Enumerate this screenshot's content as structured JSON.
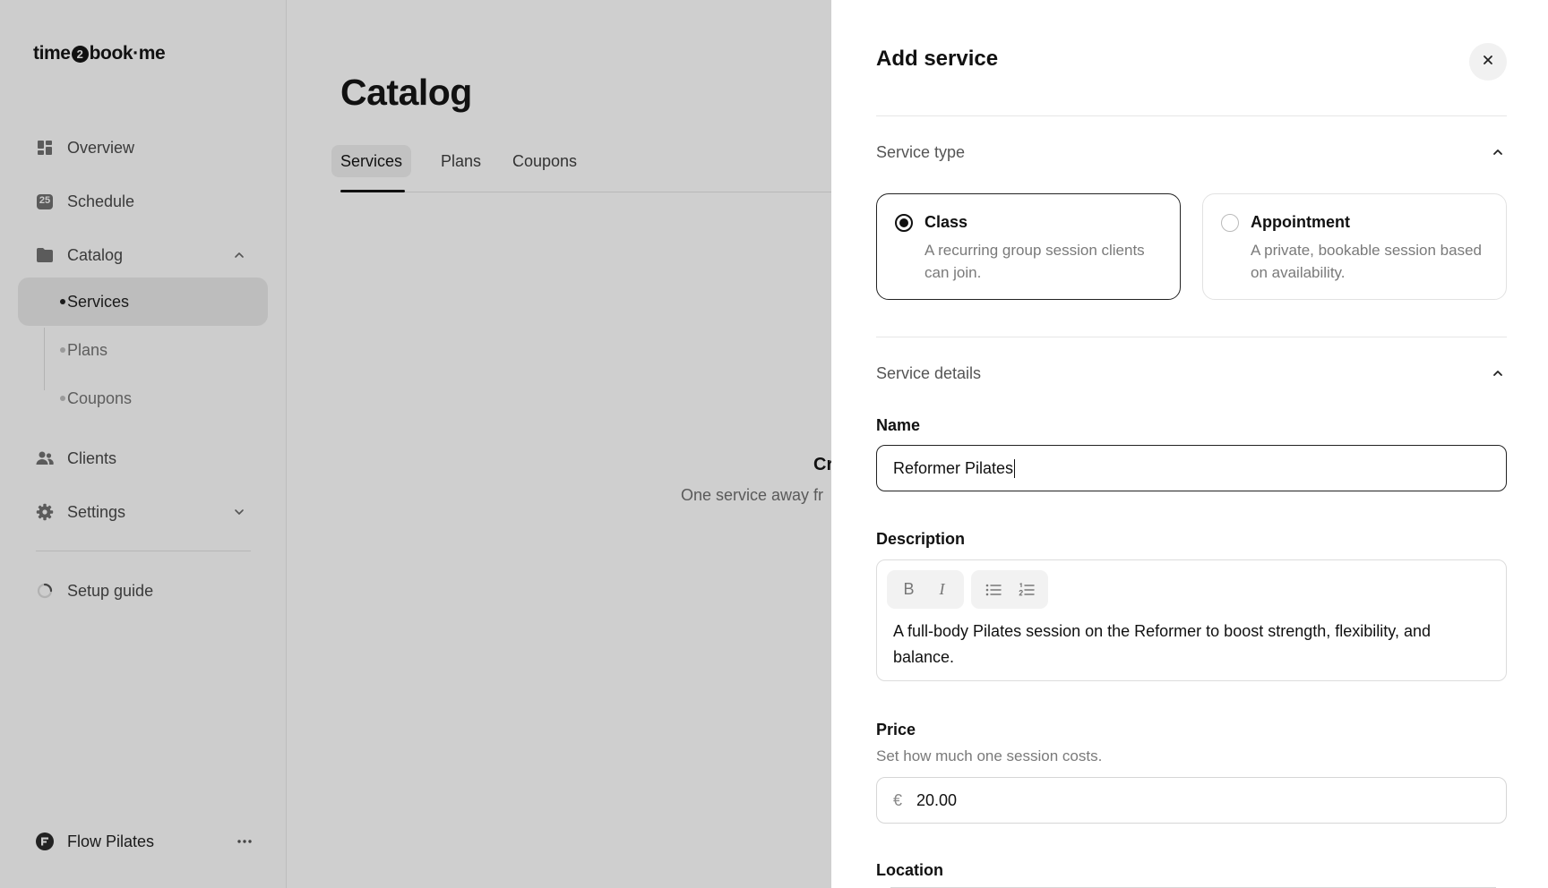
{
  "app": {
    "logo_left": "time",
    "logo_badge": "2",
    "logo_right": "book·me"
  },
  "sidebar": {
    "items": [
      {
        "label": "Overview",
        "icon": "dashboard-icon"
      },
      {
        "label": "Schedule",
        "icon": "calendar-icon"
      },
      {
        "label": "Catalog",
        "icon": "folder-icon",
        "expanded": true
      },
      {
        "label": "Clients",
        "icon": "users-icon"
      },
      {
        "label": "Settings",
        "icon": "gear-icon",
        "expanded": false
      }
    ],
    "calendar_day": "25",
    "sub_items": [
      {
        "label": "Services",
        "active": true
      },
      {
        "label": "Plans",
        "active": false
      },
      {
        "label": "Coupons",
        "active": false
      }
    ],
    "setup_guide": "Setup guide",
    "workspace": "Flow Pilates"
  },
  "main": {
    "title": "Catalog",
    "tabs": [
      {
        "label": "Services",
        "active": true
      },
      {
        "label": "Plans",
        "active": false
      },
      {
        "label": "Coupons",
        "active": false
      }
    ],
    "empty_title": "Cr",
    "empty_subtitle": "One service away fr"
  },
  "panel": {
    "title": "Add service",
    "service_type": {
      "heading": "Service type",
      "options": [
        {
          "title": "Class",
          "description": "A recurring group session clients can join.",
          "selected": true
        },
        {
          "title": "Appointment",
          "description": "A private, bookable session based on availability.",
          "selected": false
        }
      ]
    },
    "service_details": {
      "heading": "Service details",
      "name_label": "Name",
      "name_value": "Reformer Pilates",
      "description_label": "Description",
      "description_value": "A full-body Pilates session on the Reformer to boost strength, flexibility, and balance.",
      "toolbar": {
        "bold": "B",
        "italic": "I"
      },
      "price_label": "Price",
      "price_hint": "Set how much one session costs.",
      "currency": "€",
      "price_value": "20.00",
      "location_label": "Location"
    }
  },
  "colors": {
    "overlay": "#cfcfcf",
    "panel_bg": "#ffffff",
    "text": "#111111",
    "muted": "#7a7a7a"
  }
}
